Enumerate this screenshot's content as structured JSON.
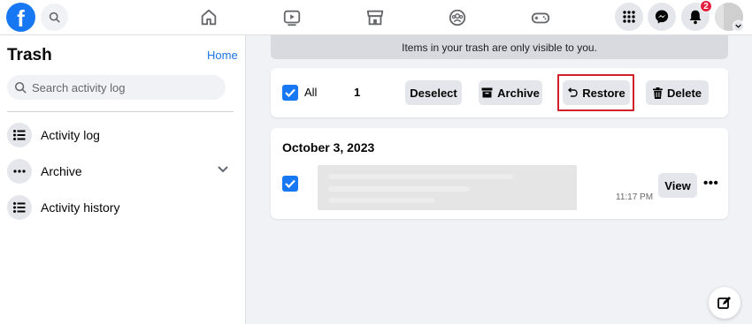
{
  "topbar": {
    "logo_letter": "f",
    "notification_count": "2",
    "nav_icons": [
      "home-icon",
      "video-icon",
      "marketplace-icon",
      "groups-icon",
      "gaming-icon"
    ],
    "right_icons": [
      "menu-grid-icon",
      "messenger-icon",
      "bell-icon"
    ]
  },
  "sidebar": {
    "title": "Trash",
    "home_link": "Home",
    "search_placeholder": "Search activity log",
    "items": [
      {
        "label": "Activity log",
        "icon": "list-icon"
      },
      {
        "label": "Archive",
        "icon": "more-dots-icon"
      },
      {
        "label": "Activity history",
        "icon": "list-icon"
      }
    ]
  },
  "main": {
    "banner_text": "Items in your trash are only visible to you.",
    "actions": {
      "all_label": "All",
      "selected_count": "1",
      "deselect_label": "Deselect",
      "archive_label": "Archive",
      "restore_label": "Restore",
      "delete_label": "Delete"
    },
    "list": {
      "date_heading": "October 3, 2023",
      "item_time": "11:17 PM",
      "view_label": "View",
      "more_label": "•••"
    }
  },
  "colors": {
    "brand_blue": "#1877f2",
    "link_blue": "#1b74e4",
    "highlight_red": "#d0202a",
    "badge_red": "#e41e3f"
  }
}
